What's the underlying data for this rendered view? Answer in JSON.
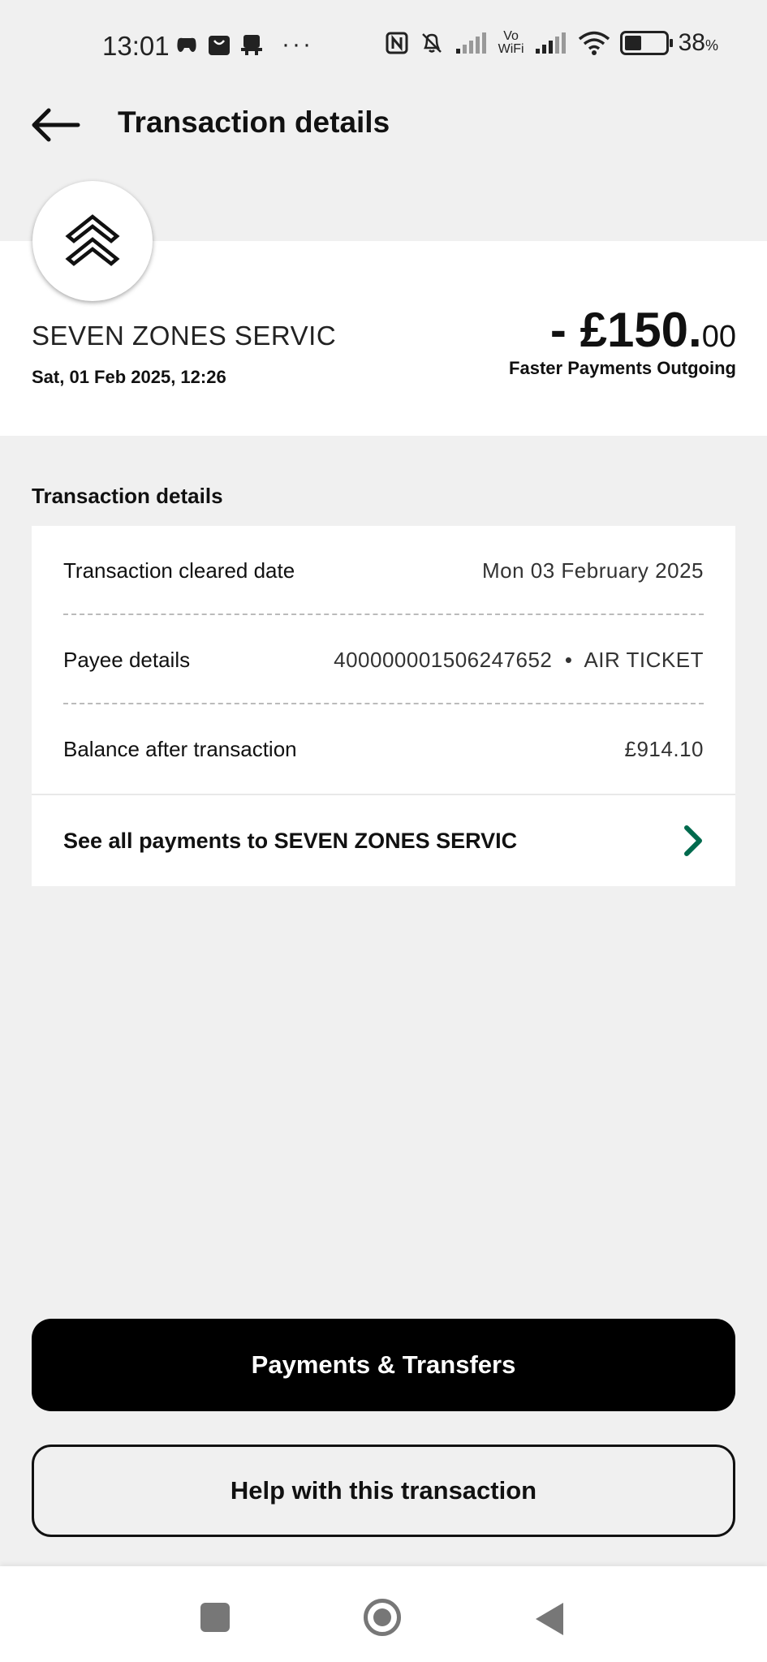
{
  "status_bar": {
    "time": "13:01",
    "dots": "···",
    "vowifi": "Vo\nWiFi",
    "battery_percent": "38",
    "battery_unit": "%",
    "icons": [
      "game-controller-icon",
      "shopping-bag-icon",
      "notification-app-icon",
      "nfc-icon",
      "bell-muted-icon",
      "signal-icon",
      "wifi-icon",
      "battery-icon"
    ]
  },
  "header": {
    "title": "Transaction details",
    "back_icon": "arrow-left-icon"
  },
  "summary": {
    "merchant": "SEVEN ZONES SERVIC",
    "date": "Sat, 01 Feb 2025, 12:26",
    "amount_main": "- £150.",
    "amount_pence": "00",
    "amount_type": "Faster Payments Outgoing",
    "logo_icon": "double-chevron-up-icon"
  },
  "details": {
    "section_title": "Transaction details",
    "rows": [
      {
        "label": "Transaction cleared date",
        "value": "Mon 03 February 2025"
      },
      {
        "label": "Payee details",
        "value": "400000001506247652  •  AIR TICKET"
      },
      {
        "label": "Balance after transaction",
        "value": "£914.10"
      }
    ],
    "see_all": "See all payments to SEVEN ZONES SERVIC",
    "accent_color": "#006a4d"
  },
  "buttons": {
    "primary": "Payments & Transfers",
    "secondary": "Help with this transaction"
  },
  "nav": {
    "icons": [
      "recents-square-icon",
      "home-circle-icon",
      "back-triangle-icon"
    ]
  }
}
